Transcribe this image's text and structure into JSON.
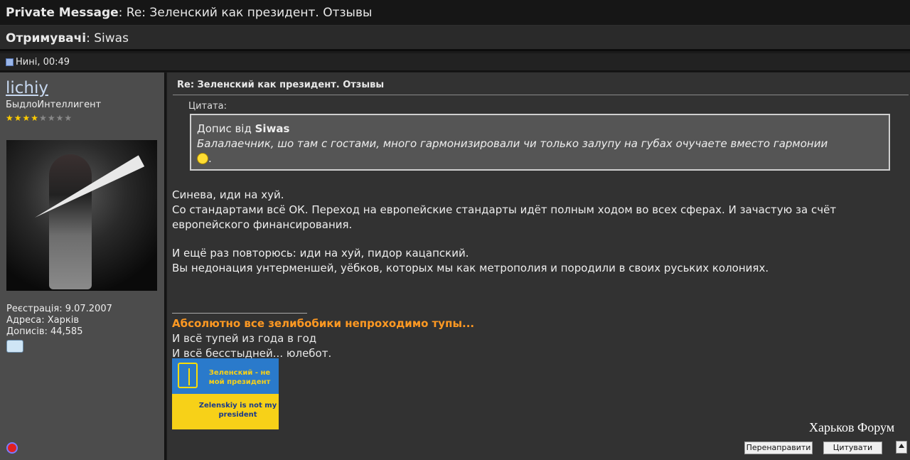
{
  "header": {
    "label": "Private Message",
    "separator": ": ",
    "subject": "Re: Зеленский как президент. Отзывы"
  },
  "recipients": {
    "label": "Отримувачі",
    "separator": ": ",
    "value": "Siwas"
  },
  "post_meta": {
    "date": "Нині, 00:49"
  },
  "author": {
    "username": "lichiy",
    "title": "БыдлоИнтеллигент",
    "rating_filled": 4,
    "rating_total": 8,
    "registration": "Реєстрація: 9.07.2007",
    "address": "Адреса: Харків",
    "posts": "Дописів: 44,585"
  },
  "post": {
    "title": "Re: Зеленский как президент. Отзывы",
    "quote_label": "Цитата:",
    "quote_author_prefix": "Допис від ",
    "quote_author": "Siwas",
    "quote_text": "Балалаечник, шо там с гостами, много гармонизировали чи только залупу на губах очучаете вместо гармонии",
    "quote_tail": ".",
    "paragraph1_line1": "Синева, иди на хуй.",
    "paragraph1_line2": "Со стандартами всё ОК. Переход на европейские стандарты идёт полным ходом во всех сферах. И зачастую за счёт европейского финансирования.",
    "paragraph2_line1": "И ещё раз повторюсь: иди на хуй, пидор кацапский.",
    "paragraph2_line2": "Вы недонация унтерменшей, уёбков, которых мы как метрополия и породили в своих руських колониях."
  },
  "signature": {
    "line1": "Абсолютно все зелибобики непроходимо тупы...",
    "line2": "И всё тупей из года в год",
    "line3": "И всё бесстыдней... юлебот.",
    "banner_top": "Зеленский - не мой президент",
    "banner_bottom": "Zelenskiy is not my president"
  },
  "footer": {
    "brand": "Харьков Форум",
    "forward_button": "Перенаправити",
    "quote_button": "Цитувати"
  },
  "colors": {
    "accent_orange": "#ff9922",
    "username_blue": "#c7d8f0",
    "banner_blue": "#2a7acb",
    "banner_yellow": "#f7d118"
  }
}
